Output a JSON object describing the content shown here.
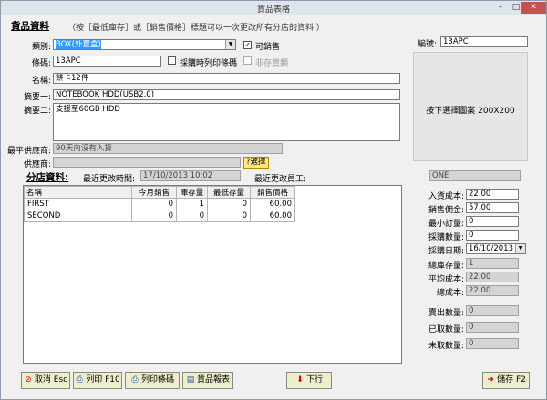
{
  "window": {
    "title": "貨品表格",
    "min": "–",
    "max": "□",
    "close": "✕"
  },
  "product": {
    "header": "貨品資料",
    "note": "（按［最低庫存］或［銷售價格］標題可以一次更改所有分店的資料.）",
    "category_label": "類別:",
    "category_value": "BOX(外置盒)",
    "sellable_label": "可銷售",
    "sellable_checked": "✓",
    "barcode_label": "條碼:",
    "barcode_value": "13APC",
    "print_barcode_label": "採購時列印條碼",
    "no_stock_label": "非存貨類",
    "name_label": "名稱:",
    "name_value": "餅卡12件",
    "summary1_label": "摘要一:",
    "summary1_value": "NOTEBOOK HDD(USB2.0)",
    "summary2_label": "摘要二:",
    "summary2_value": "支援至60GB HDD",
    "code_label": "編號:",
    "code_value": "13APC",
    "image_hint": "按下選擇圖案 200X200",
    "best_supplier_label": "最平供應商:",
    "best_supplier_value": "90天內沒有入貨",
    "supplier_label": "供應商:",
    "supplier_value": "",
    "select_button": "選擇"
  },
  "branch": {
    "header": "分店資料:",
    "last_update_label": "最近更改時間:",
    "last_update_value": "17/10/2013 10:02",
    "last_staff_label": "最近更改員工:",
    "staff_value": "ONE",
    "columns": [
      "名稱",
      "今月銷售",
      "庫存量",
      "最低存量",
      "銷售價格"
    ],
    "rows": [
      [
        "FIRST",
        "0",
        "1",
        "0",
        "60.00"
      ],
      [
        "SECOND",
        "0",
        "0",
        "0",
        "60.00"
      ]
    ]
  },
  "costs": {
    "purchase_cost_label": "入貨成本:",
    "purchase_cost_value": "22.00",
    "commission_label": "銷售佣金:",
    "commission_value": "57.00",
    "min_order_label": "最小訂量:",
    "min_order_value": "0",
    "order_qty_label": "採購數量:",
    "order_qty_value": "0",
    "order_date_label": "採購日期:",
    "order_date_value": "16/10/2013",
    "total_stock_label": "總庫存量:",
    "total_stock_value": "1",
    "avg_cost_label": "平均成本:",
    "avg_cost_value": "22.00",
    "total_cost_label": "總成本:",
    "total_cost_value": "22.00",
    "sold_qty_label": "賣出數量:",
    "sold_qty_value": "0",
    "taken_qty_label": "已取數量:",
    "taken_qty_value": "0",
    "untaken_qty_label": "未取數量:",
    "untaken_qty_value": "0"
  },
  "buttons": {
    "cancel": "取消 Esc",
    "print": "列印 F10",
    "print_barcode": "列印條碼",
    "report": "貨品報表",
    "next": "下行",
    "save": "儲存 F2"
  }
}
